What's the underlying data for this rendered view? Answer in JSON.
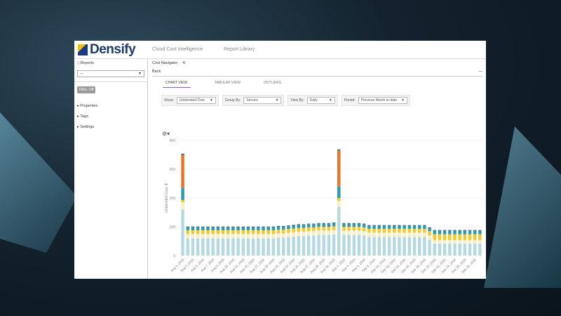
{
  "header": {
    "brand": "Densify",
    "nav": [
      "Cloud Cost Intelligence",
      "Report Library"
    ]
  },
  "sidebar": {
    "title": "Reports",
    "select_value": "---",
    "filter_button": "Filter: Off",
    "items": [
      "Properties",
      "Tags",
      "Settings"
    ]
  },
  "main": {
    "title": "Cost Navigator",
    "back": "Back",
    "tabs": [
      "CHART VIEW",
      "TABULAR VIEW",
      "OUTLIERS"
    ],
    "active_tab": "CHART VIEW",
    "filters": [
      {
        "label": "Show:",
        "value": "Unblended Cost"
      },
      {
        "label": "Group By:",
        "value": "Service"
      },
      {
        "label": "View By:",
        "value": "Daily"
      },
      {
        "label": "Period:",
        "value": "Previous Month to date"
      }
    ]
  },
  "colors": {
    "accent": "#8a5ab5",
    "series": [
      "#b4d9e0",
      "#f9eec0",
      "#f5c928",
      "#2a9bb0",
      "#e8742a",
      "#3d6b78"
    ]
  },
  "chart_data": {
    "type": "bar",
    "stacked": true,
    "ylabel": "Unblended Cost, $",
    "ylim": [
      0,
      400
    ],
    "yticks": [
      0,
      100,
      200,
      300,
      400
    ],
    "grid": true,
    "x_tick_labels": [
      "Aug 1, 2019",
      "Aug 3, 2019",
      "Aug 5, 2019",
      "Aug 7, 2019",
      "Aug 9, 2019",
      "Aug 11, 2019",
      "Aug 13, 2019",
      "Aug 15, 2019",
      "Aug 17, 2019",
      "Aug 19, 2019",
      "Aug 21, 2019",
      "Aug 23, 2019",
      "Aug 25, 2019",
      "Aug 27, 2019",
      "Aug 29, 2019",
      "Aug 31, 2019",
      "Sep 2, 2019",
      "Sep 4, 2019",
      "Sep 6, 2019",
      "Sep 8, 2019",
      "Sep 10, 2019",
      "Sep 12, 2019",
      "Sep 14, 2019",
      "Sep 16, 2019",
      "Sep 18, 2019",
      "Sep 20, 2019",
      "Sep 22, 2019",
      "Sep 24, 2019",
      "Sep 26, 2019",
      "Sep 28, 2019"
    ],
    "series": [
      {
        "values": [
          160,
          60,
          60,
          60,
          60,
          60,
          60,
          60,
          60,
          60,
          60,
          60,
          60,
          60,
          60,
          60,
          60,
          60,
          60,
          62,
          62,
          64,
          66,
          68,
          68,
          70,
          70,
          72,
          72,
          72,
          74,
          170,
          72,
          72,
          72,
          72,
          70,
          65,
          65,
          65,
          65,
          65,
          65,
          65,
          65,
          65,
          65,
          65,
          65,
          55,
          42,
          42,
          42,
          42,
          42,
          42,
          42,
          42,
          42,
          42
        ]
      },
      {
        "values": [
          25,
          15,
          15,
          15,
          15,
          15,
          15,
          15,
          15,
          15,
          15,
          15,
          15,
          15,
          15,
          15,
          15,
          15,
          15,
          15,
          15,
          15,
          15,
          15,
          15,
          15,
          15,
          15,
          15,
          15,
          15,
          20,
          15,
          15,
          15,
          15,
          15,
          15,
          15,
          15,
          15,
          15,
          15,
          15,
          15,
          15,
          15,
          15,
          15,
          15,
          12,
          12,
          12,
          12,
          12,
          12,
          12,
          12,
          12,
          12
        ]
      },
      {
        "values": [
          8,
          13,
          13,
          13,
          13,
          13,
          13,
          13,
          13,
          13,
          13,
          13,
          13,
          13,
          13,
          13,
          13,
          13,
          13,
          13,
          13,
          13,
          13,
          13,
          13,
          13,
          13,
          13,
          13,
          13,
          13,
          10,
          13,
          13,
          13,
          13,
          13,
          13,
          13,
          13,
          13,
          13,
          13,
          13,
          13,
          13,
          13,
          13,
          13,
          15,
          20,
          20,
          20,
          20,
          20,
          20,
          20,
          20,
          20,
          20
        ]
      },
      {
        "values": [
          42,
          10,
          10,
          10,
          10,
          10,
          10,
          10,
          10,
          10,
          10,
          10,
          10,
          10,
          10,
          10,
          10,
          10,
          10,
          10,
          10,
          10,
          10,
          10,
          10,
          10,
          10,
          10,
          10,
          10,
          10,
          40,
          10,
          10,
          10,
          10,
          10,
          10,
          10,
          10,
          10,
          10,
          10,
          10,
          10,
          10,
          10,
          10,
          10,
          10,
          12,
          12,
          12,
          12,
          12,
          12,
          12,
          12,
          12,
          12
        ]
      },
      {
        "values": [
          115,
          0,
          0,
          0,
          0,
          0,
          0,
          0,
          0,
          0,
          0,
          0,
          0,
          0,
          0,
          0,
          0,
          0,
          0,
          0,
          0,
          0,
          0,
          0,
          0,
          0,
          0,
          0,
          0,
          0,
          0,
          125,
          0,
          0,
          0,
          0,
          0,
          0,
          0,
          0,
          0,
          0,
          0,
          0,
          0,
          0,
          0,
          0,
          0,
          0,
          0,
          0,
          0,
          0,
          0,
          0,
          0,
          0,
          0,
          0
        ]
      },
      {
        "values": [
          4,
          3,
          3,
          3,
          3,
          3,
          3,
          3,
          3,
          3,
          3,
          3,
          3,
          3,
          3,
          3,
          3,
          3,
          3,
          3,
          3,
          3,
          3,
          3,
          3,
          3,
          3,
          3,
          3,
          3,
          3,
          4,
          3,
          3,
          3,
          3,
          3,
          3,
          3,
          3,
          3,
          3,
          3,
          3,
          3,
          3,
          3,
          3,
          3,
          3,
          3,
          3,
          3,
          3,
          3,
          3,
          3,
          3,
          3,
          3
        ]
      }
    ]
  }
}
